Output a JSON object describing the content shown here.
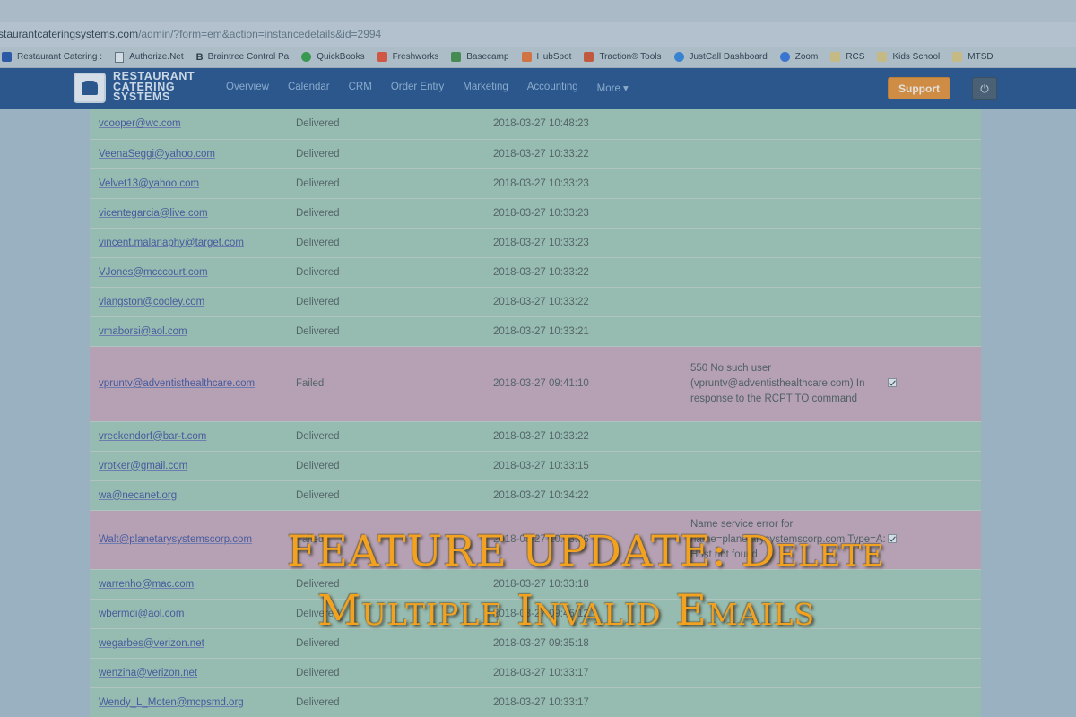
{
  "browser": {
    "address": {
      "host": "staurantcateringsystems.com",
      "path": "/admin/?form=em&action=instancedetails&id=2994"
    },
    "bookmarks": [
      {
        "label": "Restaurant Catering :",
        "icon": "rcs-bookmark-icon",
        "color": "#1c4ea3"
      },
      {
        "label": "Authorize.Net",
        "icon": "page-icon",
        "color": "#e6ecef"
      },
      {
        "label": "Braintree Control Pa",
        "icon": "braintree-icon",
        "color": "#1d2a33",
        "letter": "B"
      },
      {
        "label": "QuickBooks",
        "icon": "quickbooks-icon",
        "color": "#2c9a3b"
      },
      {
        "label": "Freshworks",
        "icon": "freshworks-icon",
        "color": "#e34a2c"
      },
      {
        "label": "Basecamp",
        "icon": "basecamp-icon",
        "color": "#3b8a3e"
      },
      {
        "label": "HubSpot",
        "icon": "hubspot-icon",
        "color": "#e26d2a"
      },
      {
        "label": "Traction® Tools",
        "icon": "traction-icon",
        "color": "#d04c24"
      },
      {
        "label": "JustCall Dashboard",
        "icon": "justcall-icon",
        "color": "#2a7fd6"
      },
      {
        "label": "Zoom",
        "icon": "zoom-icon",
        "color": "#2d6fd8"
      },
      {
        "label": "RCS",
        "icon": "folder-icon",
        "color": "#d7c27a"
      },
      {
        "label": "Kids School",
        "icon": "folder-icon",
        "color": "#d7c27a"
      },
      {
        "label": "MTSD",
        "icon": "folder-icon",
        "color": "#d7c27a"
      }
    ]
  },
  "app": {
    "logo_lines": [
      "RESTAURANT",
      "CATERING",
      "SYSTEMS"
    ],
    "menu": [
      "Overview",
      "Calendar",
      "CRM",
      "Order Entry",
      "Marketing",
      "Accounting",
      "More ▾"
    ],
    "support_label": "Support",
    "power_icon": "power-icon",
    "colors": {
      "navbar": "#1a4a86",
      "support": "#e18a2c",
      "delivered_row": "#9dc4b0",
      "failed_row": "#c2a4b4"
    }
  },
  "rows": [
    {
      "email": "vcooper@wc.com",
      "status": "Delivered",
      "time": "2018-03-27 10:48:23",
      "msg": "",
      "checked": false,
      "failed": false
    },
    {
      "email": "VeenaSeggi@yahoo.com",
      "status": "Delivered",
      "time": "2018-03-27 10:33:22",
      "msg": "",
      "checked": false,
      "failed": false
    },
    {
      "email": "Velvet13@yahoo.com",
      "status": "Delivered",
      "time": "2018-03-27 10:33:23",
      "msg": "",
      "checked": false,
      "failed": false
    },
    {
      "email": "vicentegarcia@live.com",
      "status": "Delivered",
      "time": "2018-03-27 10:33:23",
      "msg": "",
      "checked": false,
      "failed": false
    },
    {
      "email": "vincent.malanaphy@target.com",
      "status": "Delivered",
      "time": "2018-03-27 10:33:23",
      "msg": "",
      "checked": false,
      "failed": false
    },
    {
      "email": "VJones@mcccourt.com",
      "status": "Delivered",
      "time": "2018-03-27 10:33:22",
      "msg": "",
      "checked": false,
      "failed": false
    },
    {
      "email": "vlangston@cooley.com",
      "status": "Delivered",
      "time": "2018-03-27 10:33:22",
      "msg": "",
      "checked": false,
      "failed": false
    },
    {
      "email": "vmaborsi@aol.com",
      "status": "Delivered",
      "time": "2018-03-27 10:33:21",
      "msg": "",
      "checked": false,
      "failed": false
    },
    {
      "email": "vpruntv@adventisthealthcare.com",
      "status": "Failed",
      "time": "2018-03-27 09:41:10",
      "msg": "550 No such user (vpruntv@adventisthealthcare.com) In response to the RCPT TO command",
      "checked": true,
      "failed": true
    },
    {
      "email": "vreckendorf@bar-t.com",
      "status": "Delivered",
      "time": "2018-03-27 10:33:22",
      "msg": "",
      "checked": false,
      "failed": false
    },
    {
      "email": "vrotker@gmail.com",
      "status": "Delivered",
      "time": "2018-03-27 10:33:15",
      "msg": "",
      "checked": false,
      "failed": false
    },
    {
      "email": "wa@necanet.org",
      "status": "Delivered",
      "time": "2018-03-27 10:34:22",
      "msg": "",
      "checked": false,
      "failed": false
    },
    {
      "email": "Walt@planetarysystemscorp.com",
      "status": "Failed",
      "time": "2018-03-27 10:03:06",
      "msg": "Name service error for name=planetarysystemscorp.com Type=A: Host not found",
      "checked": true,
      "failed": true
    },
    {
      "email": "warrenho@mac.com",
      "status": "Delivered",
      "time": "2018-03-27 10:33:18",
      "msg": "",
      "checked": false,
      "failed": false
    },
    {
      "email": "wbermdi@aol.com",
      "status": "Delivered",
      "time": "2018-03-27 09:46:12",
      "msg": "",
      "checked": false,
      "failed": false
    },
    {
      "email": "wegarbes@verizon.net",
      "status": "Delivered",
      "time": "2018-03-27 09:35:18",
      "msg": "",
      "checked": false,
      "failed": false
    },
    {
      "email": "wenziha@verizon.net",
      "status": "Delivered",
      "time": "2018-03-27 10:33:17",
      "msg": "",
      "checked": false,
      "failed": false
    },
    {
      "email": "Wendy_L_Moten@mcpsmd.org",
      "status": "Delivered",
      "time": "2018-03-27 10:33:17",
      "msg": "",
      "checked": false,
      "failed": false
    }
  ],
  "overlay": {
    "line1": "FEATURE UPDATE: Delete",
    "line2": "Multiple Invalid Emails",
    "color": "#f3a21f"
  }
}
